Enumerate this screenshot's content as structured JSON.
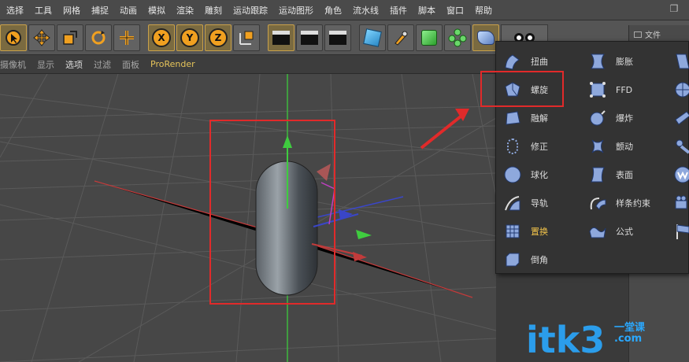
{
  "menubar": {
    "items": [
      "选择",
      "工具",
      "网格",
      "捕捉",
      "动画",
      "模拟",
      "渲染",
      "雕刻",
      "运动跟踪",
      "运动图形",
      "角色",
      "流水线",
      "插件",
      "脚本",
      "窗口",
      "帮助"
    ]
  },
  "toolbar": {
    "axis_labels": [
      "X",
      "Y",
      "Z"
    ]
  },
  "subbar": {
    "items": [
      "摄像机",
      "显示",
      "选项",
      "过滤",
      "面板",
      "ProRender"
    ]
  },
  "right_strip": {
    "tabs": [
      "文件"
    ]
  },
  "deformer_menu": {
    "col1": [
      "扭曲",
      "螺旋",
      "融解",
      "修正",
      "球化",
      "导轨",
      "置换",
      "倒角"
    ],
    "col2": [
      "膨胀",
      "FFD",
      "爆炸",
      "颤动",
      "表面",
      "样条约束",
      "公式"
    ],
    "highlighted_label": "置换",
    "selected_item": "螺旋"
  },
  "watermark": {
    "brand": "itk3",
    "suffix": ".com",
    "cn": "一堂课"
  },
  "colors": {
    "annotation_red": "#e12a2a",
    "accent_orange": "#f0a020",
    "highlight_text": "#f0c24a"
  }
}
